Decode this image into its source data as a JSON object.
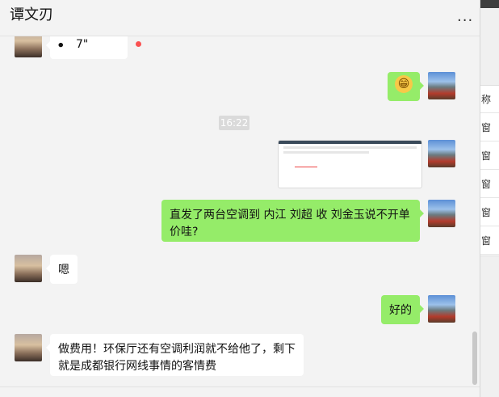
{
  "header": {
    "title": "谭文刃",
    "more_label": "..."
  },
  "messages": {
    "voice": {
      "duration": "7\""
    },
    "emoji": "😁",
    "time": "16:22",
    "m_text1": "直发了两台空调到  内江   刘超 收  刘金玉说不开单价哇?",
    "m_reply1": "嗯",
    "m_reply2": "好的",
    "m_text2": "做费用！环保厅还有空调利润就不给他了，剩下就是成都银行网线事情的客情费"
  },
  "side_panel": {
    "items": [
      "称",
      "窗",
      "窗",
      "窗",
      "窗",
      "窗"
    ]
  },
  "colors": {
    "bubble_self": "#95ec69",
    "bubble_other": "#ffffff",
    "background": "#f3f3f3",
    "unread_dot": "#fa5151"
  }
}
